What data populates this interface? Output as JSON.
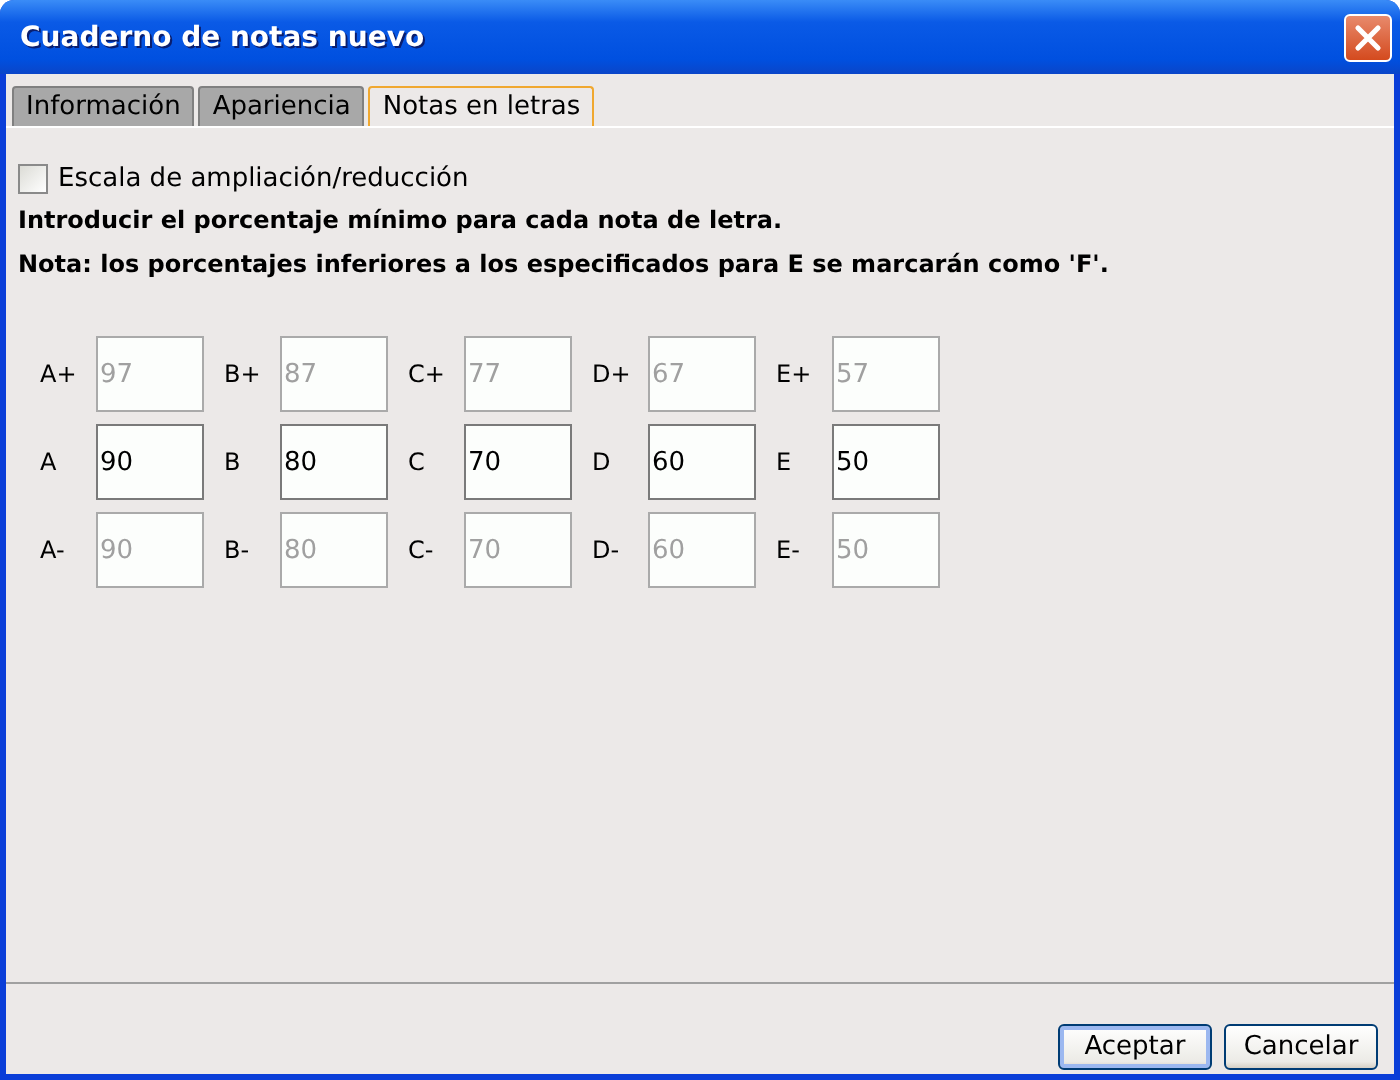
{
  "window": {
    "title": "Cuaderno de notas nuevo"
  },
  "tabs": [
    {
      "label": "Información",
      "selected": false
    },
    {
      "label": "Apariencia",
      "selected": false
    },
    {
      "label": "Notas en letras",
      "selected": true
    }
  ],
  "scale_checkbox": {
    "label": "Escala de ampliación/reducción",
    "checked": false
  },
  "instructions": [
    "Introducir el porcentaje mínimo para cada nota de letra.",
    "Nota: los porcentajes inferiores a los especificados para E se marcarán como 'F'."
  ],
  "grade_rows": [
    [
      {
        "label": "A+",
        "value": "97",
        "disabled": true
      },
      {
        "label": "B+",
        "value": "87",
        "disabled": true
      },
      {
        "label": "C+",
        "value": "77",
        "disabled": true
      },
      {
        "label": "D+",
        "value": "67",
        "disabled": true
      },
      {
        "label": "E+",
        "value": "57",
        "disabled": true
      }
    ],
    [
      {
        "label": "A",
        "value": "90",
        "disabled": false
      },
      {
        "label": "B",
        "value": "80",
        "disabled": false
      },
      {
        "label": "C",
        "value": "70",
        "disabled": false
      },
      {
        "label": "D",
        "value": "60",
        "disabled": false
      },
      {
        "label": "E",
        "value": "50",
        "disabled": false
      }
    ],
    [
      {
        "label": "A-",
        "value": "90",
        "disabled": true
      },
      {
        "label": "B-",
        "value": "80",
        "disabled": true
      },
      {
        "label": "C-",
        "value": "70",
        "disabled": true
      },
      {
        "label": "D-",
        "value": "60",
        "disabled": true
      },
      {
        "label": "E-",
        "value": "50",
        "disabled": true
      }
    ]
  ],
  "buttons": [
    {
      "label": "Aceptar",
      "default": true
    },
    {
      "label": "Cancelar",
      "default": false
    }
  ]
}
